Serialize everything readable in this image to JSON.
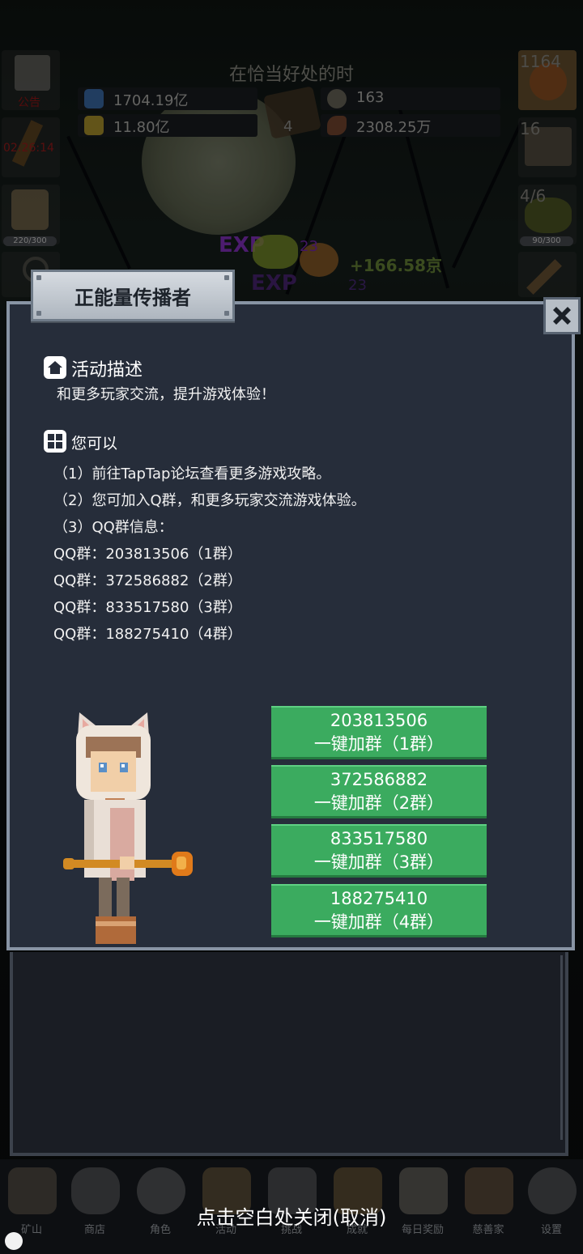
{
  "background": {
    "scene_title": "在恰当好处的时",
    "resources": [
      {
        "icon": "blue-potion-icon",
        "value": "1704.19亿"
      },
      {
        "icon": "yellow-potion-icon",
        "value": "11.80亿"
      },
      {
        "icon": "stone-icon",
        "value": "163"
      },
      {
        "icon": "meat-icon",
        "value": "2308.25万"
      }
    ],
    "book_count": "4",
    "left_slots": [
      {
        "icon": "scroll-icon",
        "label": "公告"
      },
      {
        "icon": "torch-icon",
        "label": "02:26:14"
      },
      {
        "icon": "beer-icon",
        "label": "220/300"
      }
    ],
    "right_slots": [
      {
        "icon": "potion-icon",
        "label": "1164"
      },
      {
        "icon": "chest-icon",
        "label": "16"
      },
      {
        "icon": "bush-icon",
        "label": "4/6",
        "bar": "90/300"
      }
    ],
    "exp_float": "EXP",
    "exp_float_2": "EXP",
    "exp_gain": "23",
    "exp_gain_2": "23",
    "gold_gain": "+166.58京"
  },
  "dialog": {
    "title": "正能量传播者",
    "section1_title": "活动描述",
    "section1_body": "和更多玩家交流，提升游戏体验！",
    "section2_title": "您可以",
    "lines": [
      "（1）前往TapTap论坛查看更多游戏攻略。",
      "（2）您可加入Q群，和更多玩家交流游戏体验。",
      "（3）QQ群信息：",
      "QQ群：203813506（1群）",
      "QQ群：372586882（2群）",
      "QQ群：833517580（3群）",
      "QQ群：188275410（4群）"
    ],
    "join_buttons": [
      {
        "number": "203813506",
        "label": "一键加群（1群）"
      },
      {
        "number": "372586882",
        "label": "一键加群（2群）"
      },
      {
        "number": "833517580",
        "label": "一键加群（3群）"
      },
      {
        "number": "188275410",
        "label": "一键加群（4群）"
      }
    ]
  },
  "bottom_nav": [
    {
      "label": "矿山",
      "icon": "lantern-icon"
    },
    {
      "label": "商店",
      "icon": "rock-icon"
    },
    {
      "label": "角色",
      "icon": "skull-icon"
    },
    {
      "label": "活动",
      "icon": "scroll-icon"
    },
    {
      "label": "挑战",
      "icon": "book-icon"
    },
    {
      "label": "成就",
      "icon": "key-icon"
    },
    {
      "label": "每日奖励",
      "icon": "envelope-icon"
    },
    {
      "label": "慈善家",
      "icon": "bread-icon"
    },
    {
      "label": "设置",
      "icon": "gear-icon"
    }
  ],
  "close_hint": "点击空白处关闭(取消)"
}
